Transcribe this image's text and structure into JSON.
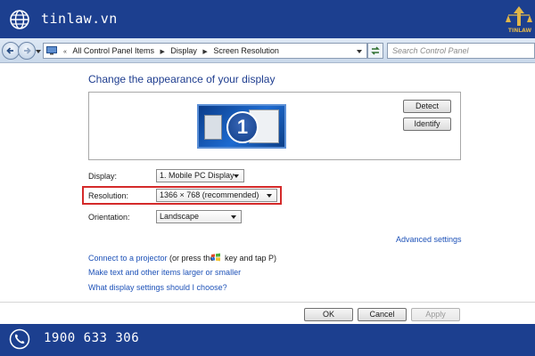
{
  "banner": {
    "site": "tinlaw.vn",
    "logo_text": "TINLAW",
    "phone": "1900 633 306",
    "color": "#1c3f8f"
  },
  "address_bar": {
    "breadcrumbs": [
      "All Control Panel Items",
      "Display",
      "Screen Resolution"
    ],
    "search_placeholder": "Search Control Panel"
  },
  "page": {
    "title": "Change the appearance of your display",
    "monitor_number": "1",
    "detect_label": "Detect",
    "identify_label": "Identify"
  },
  "settings": {
    "display_label": "Display:",
    "display_value": "1. Mobile PC Display",
    "resolution_label": "Resolution:",
    "resolution_value": "1366 × 768 (recommended)",
    "orientation_label": "Orientation:",
    "orientation_value": "Landscape",
    "advanced_link": "Advanced settings"
  },
  "links": {
    "projector_link": "Connect to a projector",
    "projector_suffix_1": "(or press the",
    "projector_suffix_2": "key and tap P)",
    "text_size_link": "Make text and other items larger or smaller",
    "help_link": "What display settings should I choose?"
  },
  "footer": {
    "ok_label": "OK",
    "cancel_label": "Cancel",
    "apply_label": "Apply"
  },
  "icons": [
    "globe-icon",
    "tinlaw-logo-icon",
    "back-arrow-icon",
    "forward-arrow-icon",
    "control-panel-icon",
    "refresh-icon",
    "search-icon",
    "windows-key-icon",
    "phone-icon"
  ]
}
